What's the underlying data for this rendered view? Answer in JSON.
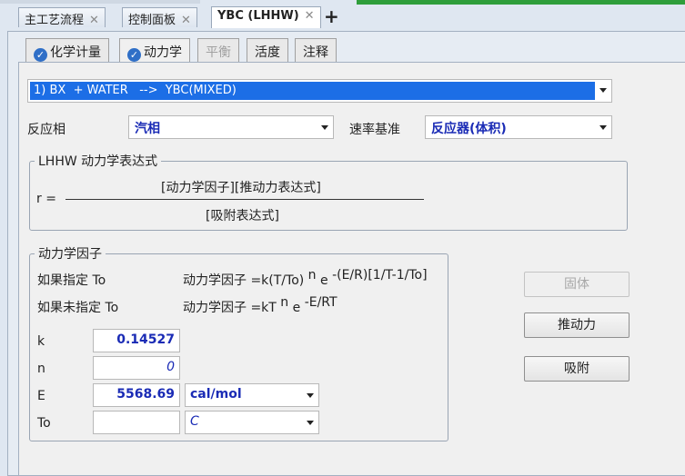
{
  "doc_tabs": [
    {
      "label": "主工艺流程",
      "close": "✕"
    },
    {
      "label": "控制面板",
      "close": "✕"
    },
    {
      "label": "YBC (LHHW)",
      "close": "✕"
    }
  ],
  "add_tab": "+",
  "sub_tabs": [
    {
      "label": "化学计量",
      "icon": "check-circle-icon"
    },
    {
      "label": "动力学",
      "icon": "check-circle-icon"
    },
    {
      "label": "平衡"
    },
    {
      "label": "活度"
    },
    {
      "label": "注释"
    }
  ],
  "reaction": {
    "selected": "1) BX  + WATER   -->  YBC(MIXED)"
  },
  "phase": {
    "label": "反应相",
    "value": "汽相"
  },
  "rate_basis": {
    "label": "速率基准",
    "value": "反应器(体积)"
  },
  "lhhw": {
    "title": "LHHW 动力学表达式",
    "r_label": "r =",
    "numerator": "[动力学因子][推动力表达式]",
    "denominator": "[吸附表达式]"
  },
  "kinetic_factor": {
    "title": "动力学因子",
    "if_to_label": "如果指定 To",
    "if_to_expr_pre": "动力学因子  =k(T/To) ",
    "if_to_n": "n",
    "if_to_e": " e ",
    "if_to_exp": "-(E/R)[1/T-1/To]",
    "if_no_to_label": "如果未指定 To",
    "if_no_to_expr_pre": "动力学因子  =kT ",
    "if_no_to_n": "n",
    "if_no_to_e": " e ",
    "if_no_to_exp": "-E/RT",
    "params": [
      {
        "name": "k",
        "value": "0.14527"
      },
      {
        "name": "n",
        "value": "0"
      },
      {
        "name": "E",
        "value": "5568.69",
        "unit": "cal/mol"
      },
      {
        "name": "To",
        "value": "",
        "unit": "C"
      }
    ]
  },
  "buttons": {
    "solid": "固体",
    "driving_force": "推动力",
    "adsorption": "吸附"
  },
  "colors": {
    "accent_blue": "#1c6ee6",
    "value_blue": "#1a2bb5",
    "green_bar": "#2f9e3b"
  }
}
